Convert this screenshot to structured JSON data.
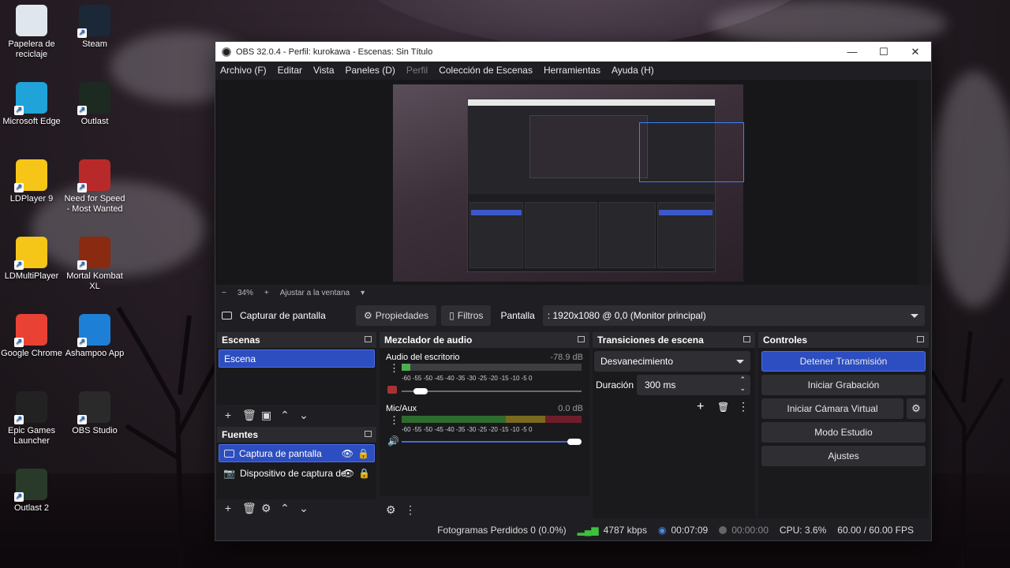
{
  "desktop_icons": [
    {
      "label": "Papelera de reciclaje",
      "icon": "recycle-bin-icon",
      "color": "#dfe6ee"
    },
    {
      "label": "Steam",
      "icon": "steam-icon",
      "color": "#1b2838"
    },
    {
      "label": "Microsoft Edge",
      "icon": "edge-icon",
      "color": "#1fa3d8"
    },
    {
      "label": "Outlast",
      "icon": "outlast-icon",
      "color": "#1c2a22"
    },
    {
      "label": "LDPlayer 9",
      "icon": "ldplayer-icon",
      "color": "#f5c518"
    },
    {
      "label": "Need for Speed - Most Wanted",
      "icon": "nfs-icon",
      "color": "#b82a2a"
    },
    {
      "label": "LDMultiPlayer",
      "icon": "ldmultiplayer-icon",
      "color": "#f5c518"
    },
    {
      "label": "Mortal Kombat XL",
      "icon": "mortal-kombat-icon",
      "color": "#8a2a10"
    },
    {
      "label": "Google Chrome",
      "icon": "chrome-icon",
      "color": "#e94235"
    },
    {
      "label": "Ashampoo App",
      "icon": "ashampoo-icon",
      "color": "#1e7fd6"
    },
    {
      "label": "Epic Games Launcher",
      "icon": "epic-games-icon",
      "color": "#222222"
    },
    {
      "label": "OBS Studio",
      "icon": "obs-icon",
      "color": "#2a2a2a"
    },
    {
      "label": "Outlast 2",
      "icon": "outlast2-icon",
      "color": "#2a3a2a"
    }
  ],
  "window": {
    "title": "OBS 32.0.4 - Perfil: kurokawa - Escenas: Sin Título",
    "minimize": "—",
    "maximize": "☐",
    "close": "✕"
  },
  "menu": [
    "Archivo (F)",
    "Editar",
    "Vista",
    "Paneles (D)",
    "Perfil",
    "Colección de Escenas",
    "Herramientas",
    "Ayuda (H)"
  ],
  "zoom": {
    "minus": "−",
    "level": "34%",
    "plus": "+",
    "fit": "Ajustar a la ventana"
  },
  "source_bar": {
    "source": "Capturar de pantalla",
    "properties": "Propiedades",
    "filters": "Filtros",
    "display_label": "Pantalla",
    "display_value": ": 1920x1080 @ 0,0 (Monitor principal)"
  },
  "scenes": {
    "title": "Escenas",
    "items": [
      "Escena"
    ]
  },
  "sources": {
    "title": "Fuentes",
    "items": [
      "Captura de pantalla",
      "Dispositivo de captura de"
    ]
  },
  "mixer": {
    "title": "Mezclador de audio",
    "channels": [
      {
        "name": "Audio del escritorio",
        "db": "-78.9 dB",
        "level": 0.05
      },
      {
        "name": "Mic/Aux",
        "db": "0.0 dB",
        "level": 1.0
      }
    ],
    "ticks": "-60 -55 -50 -45 -40 -35 -30 -25 -20 -15 -10 -5 0"
  },
  "transitions": {
    "title": "Transiciones de escena",
    "type": "Desvanecimiento",
    "duration_label": "Duración",
    "duration": "300 ms"
  },
  "controls": {
    "title": "Controles",
    "stop_stream": "Detener Transmisión",
    "start_record": "Iniciar Grabación",
    "virtual_cam": "Iniciar Cámara Virtual",
    "studio_mode": "Modo Estudio",
    "settings": "Ajustes",
    "accent": "#2d4ec0"
  },
  "status": {
    "dropped": "Fotogramas Perdidos 0 (0.0%)",
    "bitrate": "4787 kbps",
    "stream_time": "00:07:09",
    "rec_time": "00:00:00",
    "cpu": "CPU: 3.6%",
    "fps": "60.00 / 60.00 FPS"
  }
}
